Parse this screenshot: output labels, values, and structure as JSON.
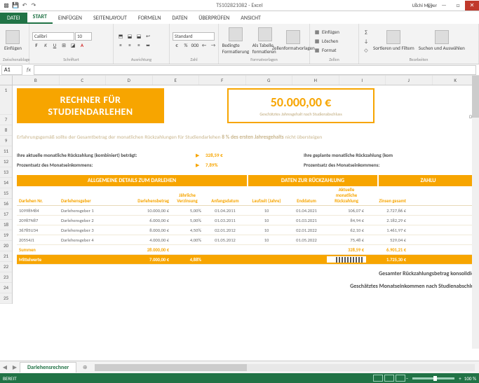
{
  "app": {
    "doc_title": "TS102821082 - Excel",
    "user": "Uschi Meyer",
    "ready": "BEREIT",
    "zoom": "100 %"
  },
  "ribbon": {
    "file": "DATEI",
    "tabs": [
      "START",
      "EINFÜGEN",
      "SEITENLAYOUT",
      "FORMELN",
      "DATEN",
      "ÜBERPRÜFEN",
      "ANSICHT"
    ],
    "font_name": "Calibri",
    "font_size": "10",
    "number_format": "Standard",
    "groups": {
      "clipboard": "Zwischenablage",
      "font": "Schriftart",
      "alignment": "Ausrichtung",
      "number": "Zahl",
      "styles": "Formatvorlagen",
      "cells": "Zellen",
      "editing": "Bearbeiten"
    },
    "buttons": {
      "paste": "Einfügen",
      "cond_format": "Bedingte Formatierung",
      "format_table": "Als Tabelle formatieren",
      "cell_styles": "Zellenformatvorlagen",
      "insert": "Einfügen",
      "delete": "Löschen",
      "format": "Format",
      "autosum": "∑",
      "sort_filter": "Sortieren und Filtern",
      "find_select": "Suchen und Auswählen"
    }
  },
  "namebox": "A1",
  "columns": [
    "B",
    "C",
    "D",
    "E",
    "F",
    "G",
    "H",
    "I",
    "J",
    "K"
  ],
  "rows_left": [
    "1",
    "7",
    "8",
    "9",
    "11",
    "12",
    "13",
    "14",
    "15",
    "16",
    "17",
    "18",
    "19",
    "20",
    "21",
    "22",
    "23",
    "24",
    "25"
  ],
  "title_box": {
    "line1": "RECHNER FÜR",
    "line2": "STUDIENDARLEHEN"
  },
  "salary_box": {
    "amount": "50.000,00 €",
    "caption": "Geschätztes Jahresgehalt nach Studienabschluss"
  },
  "dat_cutoff": "Dat",
  "advice": {
    "pre": "Erfahrungsgemäß sollte der Gesamtbetrag der monatlichen Rückzahlungen für Studiendarlehen ",
    "bold": "8 % des ersten Jahresgehalts",
    "post": " nicht übersteigen"
  },
  "metrics": {
    "row1_label": "Ihre aktuelle monatliche Rückzahlung (kombiniert) beträgt:",
    "row1_val": "328,59 €",
    "row2_label": "Prozentsatz des Monatseinkommens:",
    "row2_val": "7,89%",
    "right1": "Ihre geplante monatliche Rückzahlung (kom",
    "right2": "Prozentsatz des Monatseinkommens:"
  },
  "section_headers": [
    "ALLGEMEINE DETAILS ZUM DARLEHEN",
    "DATEN ZUR RÜCKZAHLUNG",
    "ZAHLU"
  ],
  "table": {
    "head": {
      "nr": "Darlehen Nr.",
      "geber": "Darlehensgeber",
      "betrag": "Darlehensbetrag",
      "zins": "Jährliche Verzinsung",
      "anfang": "Anfangsdatum",
      "lauf": "Laufzeit (Jahre)",
      "end": "Enddatum",
      "rueck": "Aktuelle monatliche Rückzahlung",
      "zges": "Zinsen gesamt"
    },
    "rows": [
      {
        "nr": "10998M84",
        "geber": "Darlehensgeber 1",
        "betrag": "10.000,00 €",
        "zins": "5,00%",
        "anfang": "01.04.2011",
        "lauf": "10",
        "end": "01.04.2021",
        "rueck": "106,07 €",
        "zges": "2.727,86 €"
      },
      {
        "nr": "20987N87",
        "geber": "Darlehensgeber 2",
        "betrag": "6.000,00 €",
        "zins": "5,00%",
        "anfang": "01.03.2011",
        "lauf": "10",
        "end": "01.03.2021",
        "rueck": "84,94 €",
        "zges": "2.182,29 €"
      },
      {
        "nr": "36785U34",
        "geber": "Darlehensgeber 3",
        "betrag": "8.000,00 €",
        "zins": "4,50%",
        "anfang": "02.01.2012",
        "lauf": "10",
        "end": "02.01.2022",
        "rueck": "62,10 €",
        "zges": "1.461,97 €"
      },
      {
        "nr": "20554J1",
        "geber": "Darlehensgeber 4",
        "betrag": "4.000,00 €",
        "zins": "4,00%",
        "anfang": "01.05.2012",
        "lauf": "10",
        "end": "01.05.2022",
        "rueck": "75,48 €",
        "zges": "529,04 €"
      }
    ],
    "sum": {
      "label": "Summen",
      "betrag": "28.000,00 €",
      "rueck": "328,59 €",
      "zges": "6.901,21 €"
    },
    "avg": {
      "label": "Mittelwerte",
      "betrag": "7.000,00 €",
      "zins": "4,88%",
      "zges": "1.725,30 €"
    }
  },
  "summary": {
    "line1": "Gesamter Rückzahlungsbetrag konsolidier",
    "line2": "Geschätztes Monatseinkommen nach Studienabschlus"
  },
  "sheet_tab": "Darlehensrechner"
}
